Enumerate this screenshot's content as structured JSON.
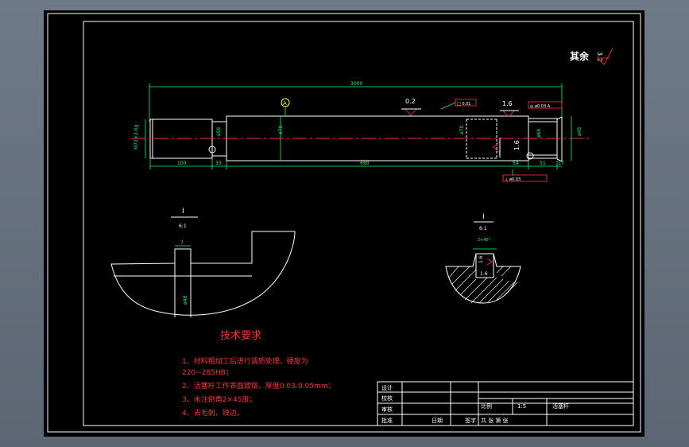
{
  "colors": {
    "background": "#000000",
    "frame": "#ffffff",
    "dimension": "#00ff66",
    "centerline": "#ff2a2a",
    "notes": "#ff3030",
    "roughness": "#ff2a2a",
    "yellow": "#ffff00"
  },
  "title_block": {
    "design_label": "设计",
    "check_label": "校核",
    "review_label": "审核",
    "approve_label": "批准",
    "date_label": "日期",
    "seal_label": "签字",
    "scale_label": "比例",
    "scale_value": "1:5",
    "sheets_label": "共 张  第 张",
    "part_name": "活塞杆"
  },
  "roughness_note": {
    "label": "其余",
    "value": "3.2"
  },
  "main_view": {
    "overall_length": "3000",
    "dim_left_thread": "100",
    "dim_groove": "33",
    "dim_middle": "690",
    "dim_right_a": "54",
    "dim_right_b": "51",
    "dim_right_c": "17",
    "thread_label": "M72×2-6g",
    "dia_left": "ø56",
    "dia_body": "ø70",
    "dia_mid": "ø70",
    "dia_right": "ø66",
    "dia_end": "ø45",
    "tolerance_1": "0.2",
    "tolerance_2": "1.6",
    "tolerance_3": "1.6",
    "gdt_1": "□ 0.01",
    "gdt_2": "◎ ø0.03 A",
    "gdt_3": "⊥ ø0.03",
    "datum": "A"
  },
  "detail_left": {
    "label": "I",
    "scale": "6:1",
    "width_dim": "7",
    "dia_dim": "ø48"
  },
  "detail_right": {
    "label": "I",
    "scale": "6:1",
    "top_dim": "2×45°",
    "inner_dim": "1.6",
    "bottom_dim": "1.6"
  },
  "tech_requirements": {
    "title": "技术要求",
    "items": [
      "1、材料粗加工后进行调质处理，硬度为",
      "220~285HB；",
      "2、活塞杆工作表面镀铬，厚度0.03-0.05mm；",
      "3、未注倒角2×45度；",
      "4、去毛刺，锐边。"
    ]
  }
}
